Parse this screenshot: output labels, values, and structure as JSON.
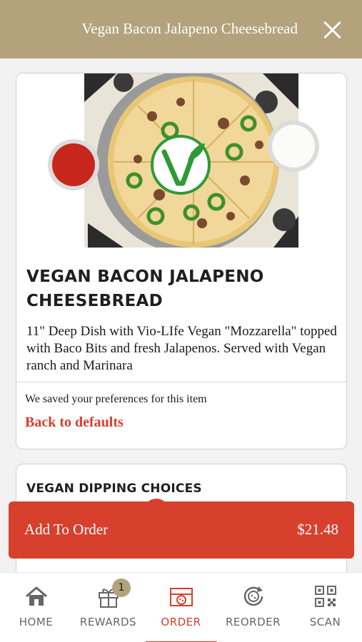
{
  "header": {
    "title": "Vegan Bacon Jalapeno Cheesebread",
    "close_icon": "close-icon"
  },
  "item": {
    "name": "VEGAN BACON JALAPENO CHEESEBREAD",
    "description": "11\" Deep Dish with Vio-LIfe Vegan \"Mozzarella\" topped with Baco Bits and fresh Jalapenos. Served with Vegan ranch and Marinara",
    "preferences_note": "We saved your preferences for this item",
    "reset_label": "Back to defaults",
    "vegan_badge_icon": "vegan-v-icon"
  },
  "sections": {
    "dipping_title": "VEGAN DIPPING CHOICES"
  },
  "cta": {
    "label": "Add To Order",
    "price": "$21.48"
  },
  "tabs": [
    {
      "label": "HOME",
      "icon": "home-icon"
    },
    {
      "label": "REWARDS",
      "icon": "gift-icon",
      "badge": "1"
    },
    {
      "label": "ORDER",
      "icon": "pizza-box-icon",
      "active": true
    },
    {
      "label": "REORDER",
      "icon": "reorder-icon"
    },
    {
      "label": "SCAN",
      "icon": "qr-code-icon"
    }
  ],
  "colors": {
    "header": "#b3a27c",
    "accent": "#d6402d",
    "vegan_green": "#2e9a35"
  }
}
